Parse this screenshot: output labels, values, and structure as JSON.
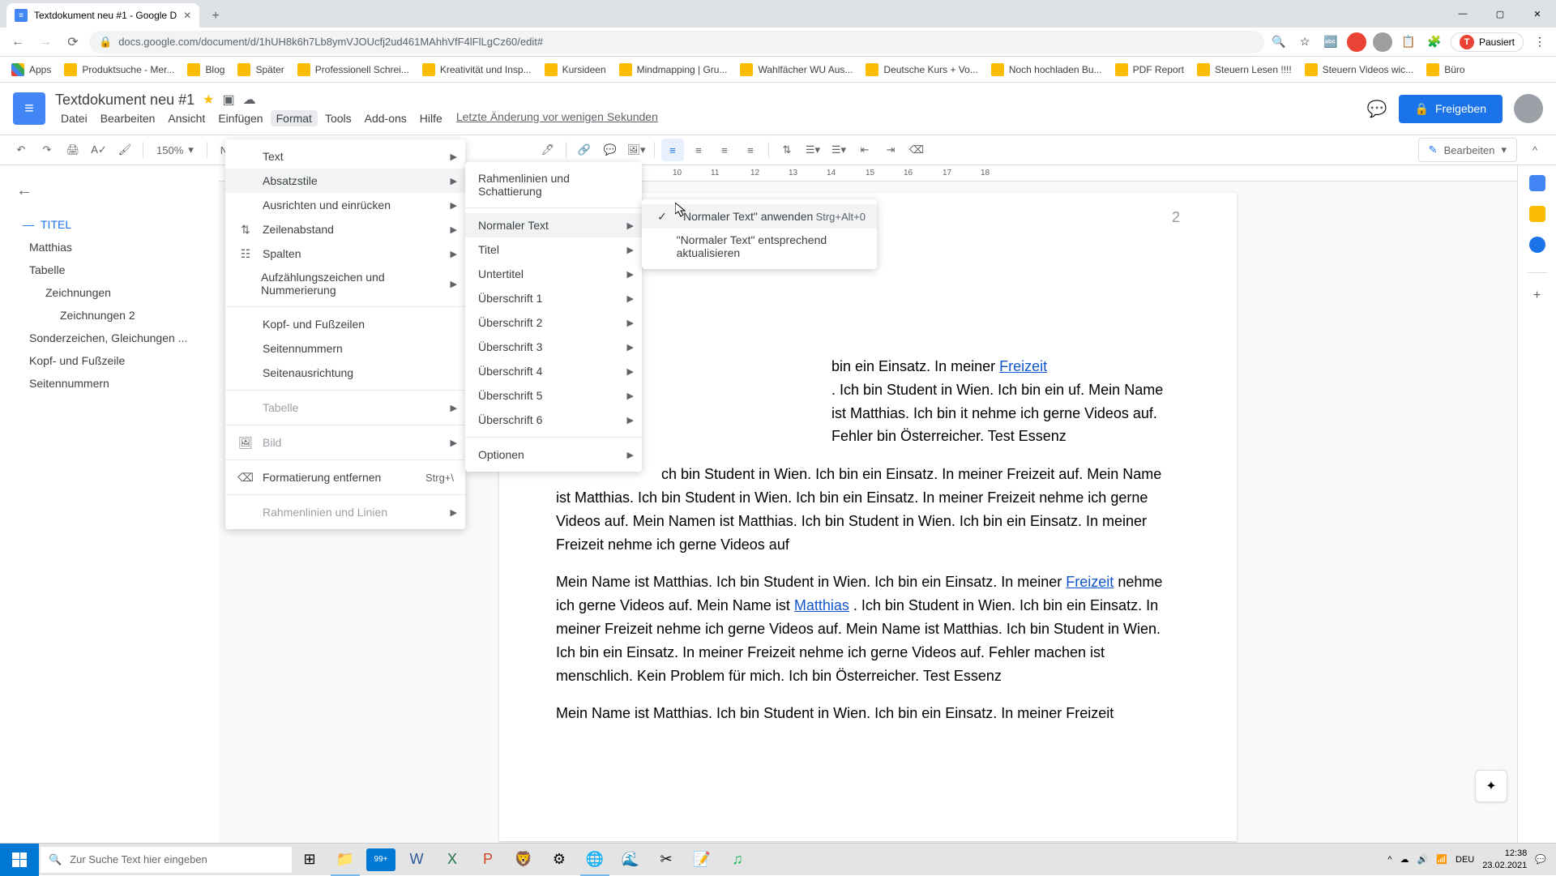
{
  "browser": {
    "tab_title": "Textdokument neu #1 - Google D",
    "url": "docs.google.com/document/d/1hUH8k6h7Lb8ymVJOUcfj2ud461MAhhVfF4lFlLgCz60/edit#",
    "paused_label": "Pausiert",
    "bookmarks": [
      {
        "label": "Apps"
      },
      {
        "label": "Produktsuche - Mer..."
      },
      {
        "label": "Blog"
      },
      {
        "label": "Später"
      },
      {
        "label": "Professionell Schrei..."
      },
      {
        "label": "Kreativität und Insp..."
      },
      {
        "label": "Kursideen"
      },
      {
        "label": "Mindmapping | Gru..."
      },
      {
        "label": "Wahlfächer WU Aus..."
      },
      {
        "label": "Deutsche Kurs + Vo..."
      },
      {
        "label": "Noch hochladen Bu..."
      },
      {
        "label": "PDF Report"
      },
      {
        "label": "Steuern Lesen !!!!"
      },
      {
        "label": "Steuern Videos wic..."
      },
      {
        "label": "Büro"
      }
    ]
  },
  "docs": {
    "title": "Textdokument neu #1",
    "menubar": [
      "Datei",
      "Bearbeiten",
      "Ansicht",
      "Einfügen",
      "Format",
      "Tools",
      "Add-ons",
      "Hilfe"
    ],
    "last_change": "Letzte Änderung vor wenigen Sekunden",
    "share": "Freigeben",
    "zoom": "150%",
    "style_select": "Normaler T...",
    "edit_mode": "Bearbeiten",
    "page_indicator": "2",
    "ruler_marks": [
      "10",
      "11",
      "12",
      "13",
      "14",
      "15",
      "16",
      "17",
      "18"
    ],
    "page_num_right": "2"
  },
  "outline": [
    {
      "label": "TITEL",
      "level": "h1",
      "active": true
    },
    {
      "label": "Matthias",
      "level": "h2"
    },
    {
      "label": "Tabelle",
      "level": "h2"
    },
    {
      "label": "Zeichnungen",
      "level": "h3"
    },
    {
      "label": "Zeichnungen 2",
      "level": "h4"
    },
    {
      "label": "Sonderzeichen, Gleichungen ...",
      "level": "h2"
    },
    {
      "label": "Kopf- und Fußzeile",
      "level": "h2"
    },
    {
      "label": "Seitennummern",
      "level": "h2"
    }
  ],
  "format_menu": {
    "text": "Text",
    "absatzstile": "Absatzstile",
    "ausrichten": "Ausrichten und einrücken",
    "zeilenabstand": "Zeilenabstand",
    "spalten": "Spalten",
    "aufzaehlung": "Aufzählungszeichen und Nummerierung",
    "kopfzeilen": "Kopf- und Fußzeilen",
    "seitennummern": "Seitennummern",
    "seitenausrichtung": "Seitenausrichtung",
    "tabelle": "Tabelle",
    "bild": "Bild",
    "formatierung_entfernen": "Formatierung entfernen",
    "formatierung_shortcut": "Strg+\\",
    "rahmenlinien": "Rahmenlinien und Linien"
  },
  "style_menu": {
    "rahmen": "Rahmenlinien und Schattierung",
    "normaler_text": "Normaler Text",
    "titel": "Titel",
    "untertitel": "Untertitel",
    "ueberschrift1": "Überschrift 1",
    "ueberschrift2": "Überschrift 2",
    "ueberschrift3": "Überschrift 3",
    "ueberschrift4": "Überschrift 4",
    "ueberschrift5": "Überschrift 5",
    "ueberschrift6": "Überschrift 6",
    "optionen": "Optionen"
  },
  "apply_menu": {
    "anwenden": "\"Normaler Text\" anwenden",
    "shortcut": "Strg+Alt+0",
    "aktualisieren": "\"Normaler Text\" entsprechend aktualisieren"
  },
  "body": {
    "p1a": "bin ein Einsatz. In meiner ",
    "p1_link1": "Freizeit",
    "p1b": ". Ich bin Student in Wien. Ich bin ein uf. Mein Name ist Matthias. Ich bin it nehme ich gerne Videos auf. Fehler bin Österreicher. Test Essenz",
    "p2": "ch bin Student in Wien. Ich bin ein Einsatz. In meiner Freizeit auf. Mein Name ist Matthias. Ich bin Student in Wien. Ich bin ein Einsatz. In meiner Freizeit nehme ich gerne Videos auf. Mein Namen ist Matthias. Ich bin Student in Wien. Ich bin ein Einsatz. In meiner Freizeit nehme ich gerne Videos auf",
    "p3a": "Mein Name ist Matthias. Ich bin Student in Wien. Ich bin ein Einsatz. In meiner ",
    "p3_link1": "Freizeit",
    "p3b": " nehme ich gerne Videos auf. Mein Name ist ",
    "p3_link2": "Matthias",
    "p3c": ". Ich bin Student in Wien. Ich bin ein Einsatz. In meiner Freizeit nehme ich gerne Videos auf. Mein Name ist Matthias. Ich bin Student in Wien. Ich bin ein Einsatz. In meiner Freizeit nehme ich gerne Videos auf. Fehler machen ist menschlich. Kein Problem für mich. Ich bin Österreicher. Test Essenz",
    "p4": "Mein Name ist Matthias. Ich bin Student in Wien. Ich bin ein Einsatz. In meiner Freizeit"
  },
  "taskbar": {
    "search_placeholder": "Zur Suche Text hier eingeben",
    "lang": "DEU",
    "time": "12:38",
    "date": "23.02.2021"
  }
}
